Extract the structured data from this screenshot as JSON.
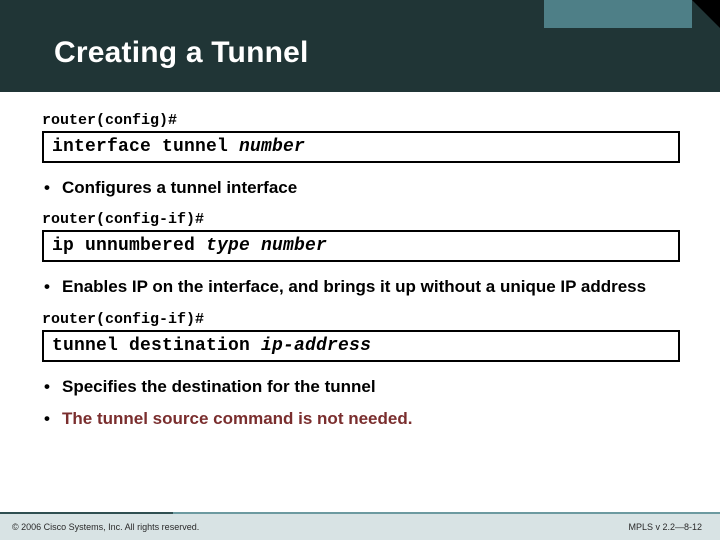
{
  "header": {
    "title": "Creating a Tunnel"
  },
  "blocks": [
    {
      "prompt": "router(config)#",
      "command": "interface tunnel ",
      "param": "number",
      "bullets": [
        {
          "text": "Configures a tunnel interface",
          "highlight": false
        }
      ]
    },
    {
      "prompt": "router(config-if)#",
      "command": "ip unnumbered ",
      "param": "type number",
      "bullets": [
        {
          "text": "Enables IP on the interface, and brings it up without a unique IP address",
          "highlight": false
        }
      ]
    },
    {
      "prompt": "router(config-if)#",
      "command": "tunnel destination ",
      "param": "ip-address",
      "bullets": [
        {
          "text": "Specifies the destination for the tunnel",
          "highlight": false
        },
        {
          "text": "The tunnel source command is not needed.",
          "highlight": true
        }
      ]
    }
  ],
  "footer": {
    "left": "© 2006 Cisco Systems, Inc. All rights reserved.",
    "right": "MPLS v 2.2—8-12"
  }
}
